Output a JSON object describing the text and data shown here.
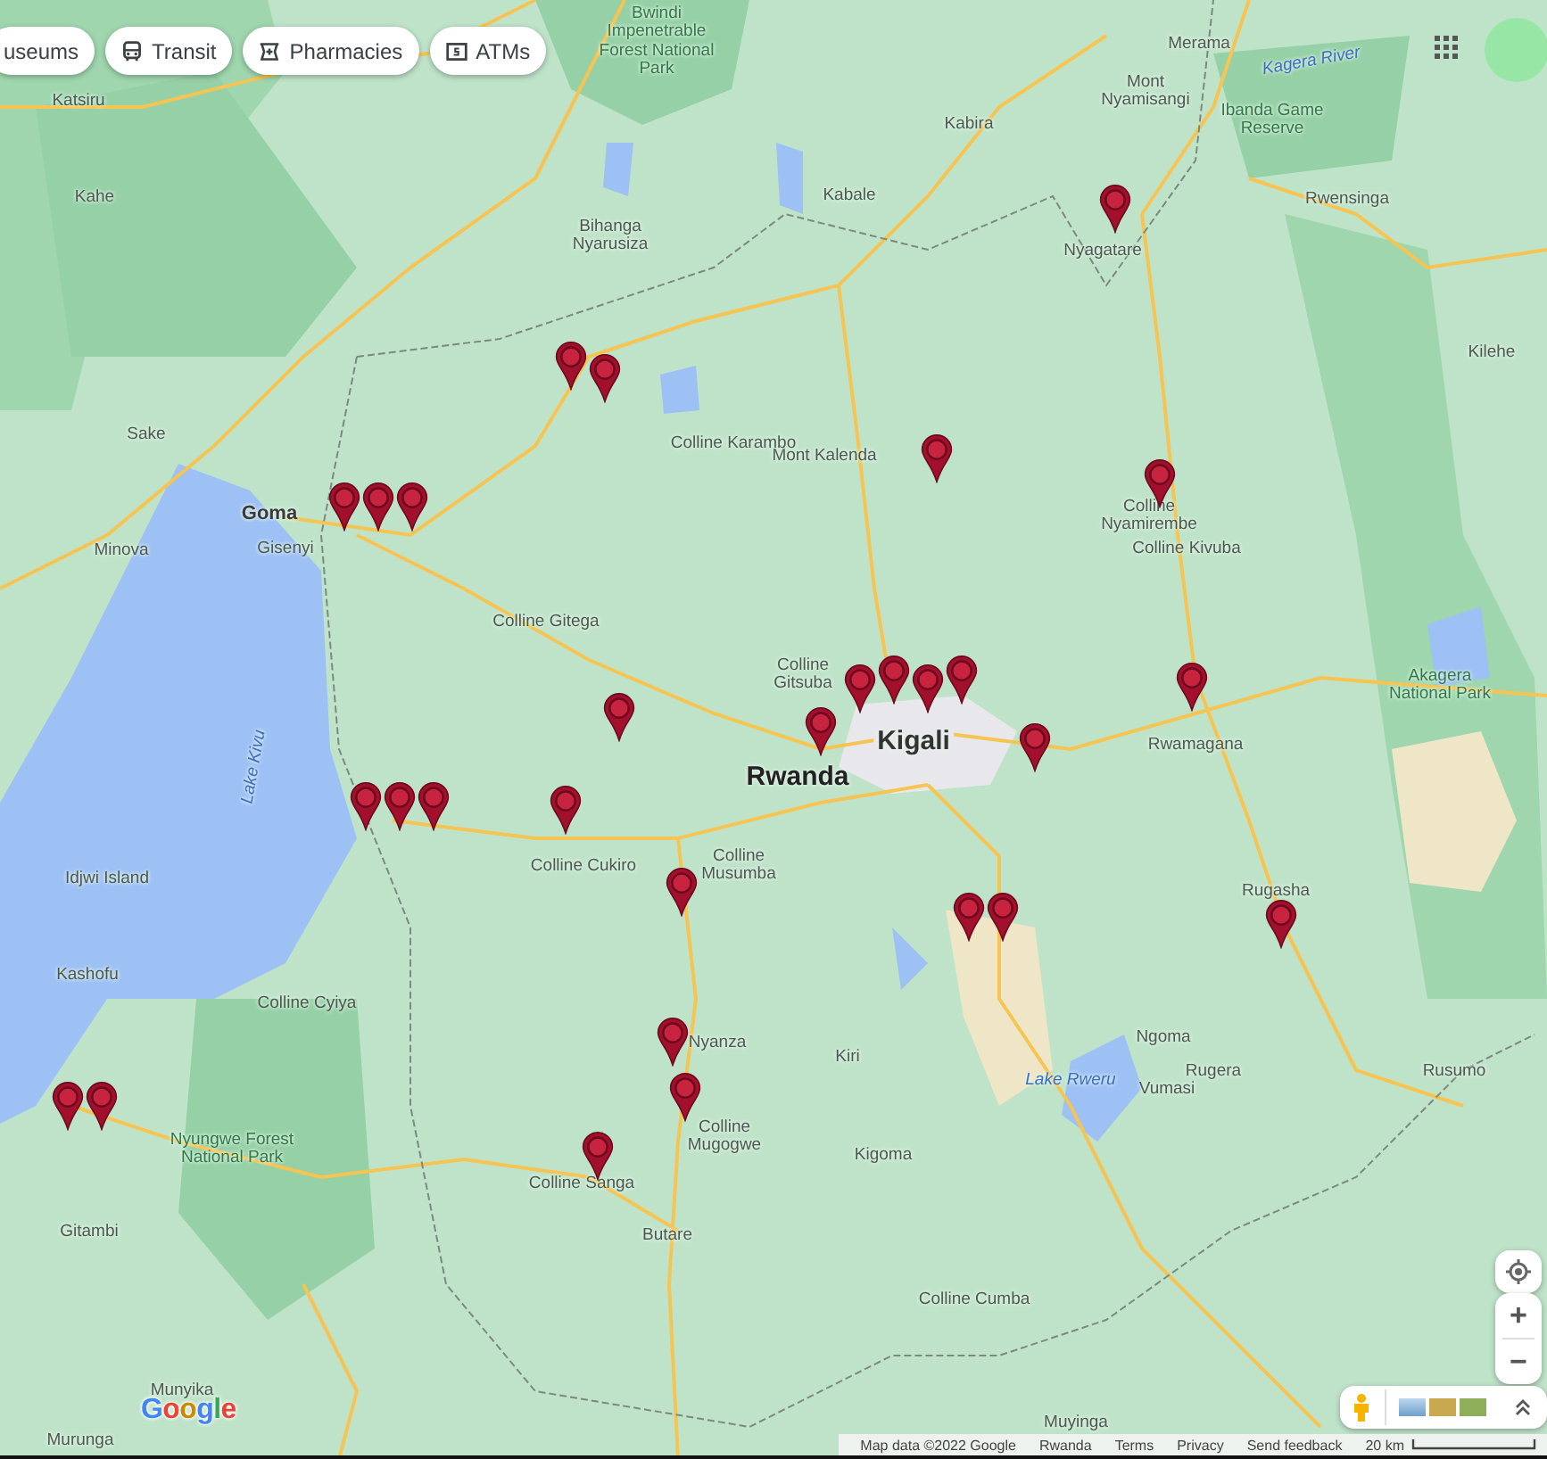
{
  "chips": [
    {
      "label": "useums"
    },
    {
      "label": "Transit"
    },
    {
      "label": "Pharmacies"
    },
    {
      "label": "ATMs"
    }
  ],
  "places": [
    {
      "name": "Katsiru",
      "kind": "town"
    },
    {
      "name": "Kahe",
      "kind": "town"
    },
    {
      "name": "Bwindi Impenetrable Forest National Park",
      "kind": "park"
    },
    {
      "name": "Kabira",
      "kind": "town"
    },
    {
      "name": "Merama",
      "kind": "town"
    },
    {
      "name": "Kagera River",
      "kind": "water"
    },
    {
      "name": "Mont Nyamisangi",
      "kind": "town"
    },
    {
      "name": "Ibanda Game Reserve",
      "kind": "park"
    },
    {
      "name": "Bihanga Nyarusiza",
      "kind": "town"
    },
    {
      "name": "Kabale",
      "kind": "town"
    },
    {
      "name": "Nyagatare",
      "kind": "town"
    },
    {
      "name": "Rwensinga",
      "kind": "town"
    },
    {
      "name": "Kilehe",
      "kind": "town"
    },
    {
      "name": "Sake",
      "kind": "town"
    },
    {
      "name": "Mont Kalenda",
      "kind": "town"
    },
    {
      "name": "Colline Karambo",
      "kind": "town"
    },
    {
      "name": "Colline Nyamirembe",
      "kind": "town"
    },
    {
      "name": "Colline Kivuba",
      "kind": "town"
    },
    {
      "name": "Goma",
      "kind": "city"
    },
    {
      "name": "Minova",
      "kind": "town"
    },
    {
      "name": "Gisenyi",
      "kind": "town"
    },
    {
      "name": "Colline Gitega",
      "kind": "town"
    },
    {
      "name": "Colline Gitsuba",
      "kind": "town"
    },
    {
      "name": "Kigali",
      "kind": "capital"
    },
    {
      "name": "Rwanda",
      "kind": "country"
    },
    {
      "name": "Rwamagana",
      "kind": "town"
    },
    {
      "name": "Akagera National Park",
      "kind": "park"
    },
    {
      "name": "Lake Kivu",
      "kind": "water"
    },
    {
      "name": "Colline Cukiro",
      "kind": "town"
    },
    {
      "name": "Colline Musumba",
      "kind": "town"
    },
    {
      "name": "Idjwi Island",
      "kind": "town"
    },
    {
      "name": "Rugasha",
      "kind": "town"
    },
    {
      "name": "Kashofu",
      "kind": "town"
    },
    {
      "name": "Colline Cyiya",
      "kind": "town"
    },
    {
      "name": "Ngoma",
      "kind": "town"
    },
    {
      "name": "Kiri",
      "kind": "town"
    },
    {
      "name": "Rugera",
      "kind": "town"
    },
    {
      "name": "Vumasi",
      "kind": "town"
    },
    {
      "name": "Rusumo",
      "kind": "town"
    },
    {
      "name": "Nyanza",
      "kind": "town"
    },
    {
      "name": "Colline Mugogwe",
      "kind": "town"
    },
    {
      "name": "Kigoma",
      "kind": "town"
    },
    {
      "name": "Nyungwe Forest National Park",
      "kind": "park"
    },
    {
      "name": "Colline Sanga",
      "kind": "town"
    },
    {
      "name": "Gitambi",
      "kind": "town"
    },
    {
      "name": "Butare",
      "kind": "town"
    },
    {
      "name": "Colline Cumba",
      "kind": "town"
    },
    {
      "name": "Muyinga",
      "kind": "town"
    },
    {
      "name": "Munyika",
      "kind": "town"
    },
    {
      "name": "Murunga",
      "kind": "town"
    },
    {
      "name": "Lake Rweru",
      "kind": "water"
    }
  ],
  "markers": [
    {
      "kind": "pin"
    },
    {
      "kind": "pin"
    },
    {
      "kind": "pin"
    },
    {
      "kind": "pin"
    },
    {
      "kind": "pin"
    },
    {
      "kind": "pin"
    },
    {
      "kind": "pin"
    },
    {
      "kind": "pin"
    },
    {
      "kind": "pin"
    },
    {
      "kind": "pin"
    },
    {
      "kind": "pin"
    },
    {
      "kind": "pin"
    },
    {
      "kind": "pin"
    },
    {
      "kind": "pin"
    },
    {
      "kind": "pin"
    },
    {
      "kind": "pin"
    },
    {
      "kind": "pin"
    },
    {
      "kind": "pin"
    },
    {
      "kind": "pin"
    },
    {
      "kind": "pin"
    },
    {
      "kind": "pin"
    },
    {
      "kind": "pin"
    },
    {
      "kind": "pin"
    },
    {
      "kind": "pin"
    },
    {
      "kind": "pin"
    },
    {
      "kind": "pin"
    },
    {
      "kind": "pin"
    },
    {
      "kind": "pin"
    },
    {
      "kind": "pin"
    }
  ],
  "zoom": {
    "zoom_in": "+",
    "zoom_out": "−"
  },
  "logo": "Google",
  "attribution": [
    "Map data ©2022 Google",
    "Rwanda",
    "Terms",
    "Privacy",
    "Send feedback"
  ],
  "scale": "20 km"
}
